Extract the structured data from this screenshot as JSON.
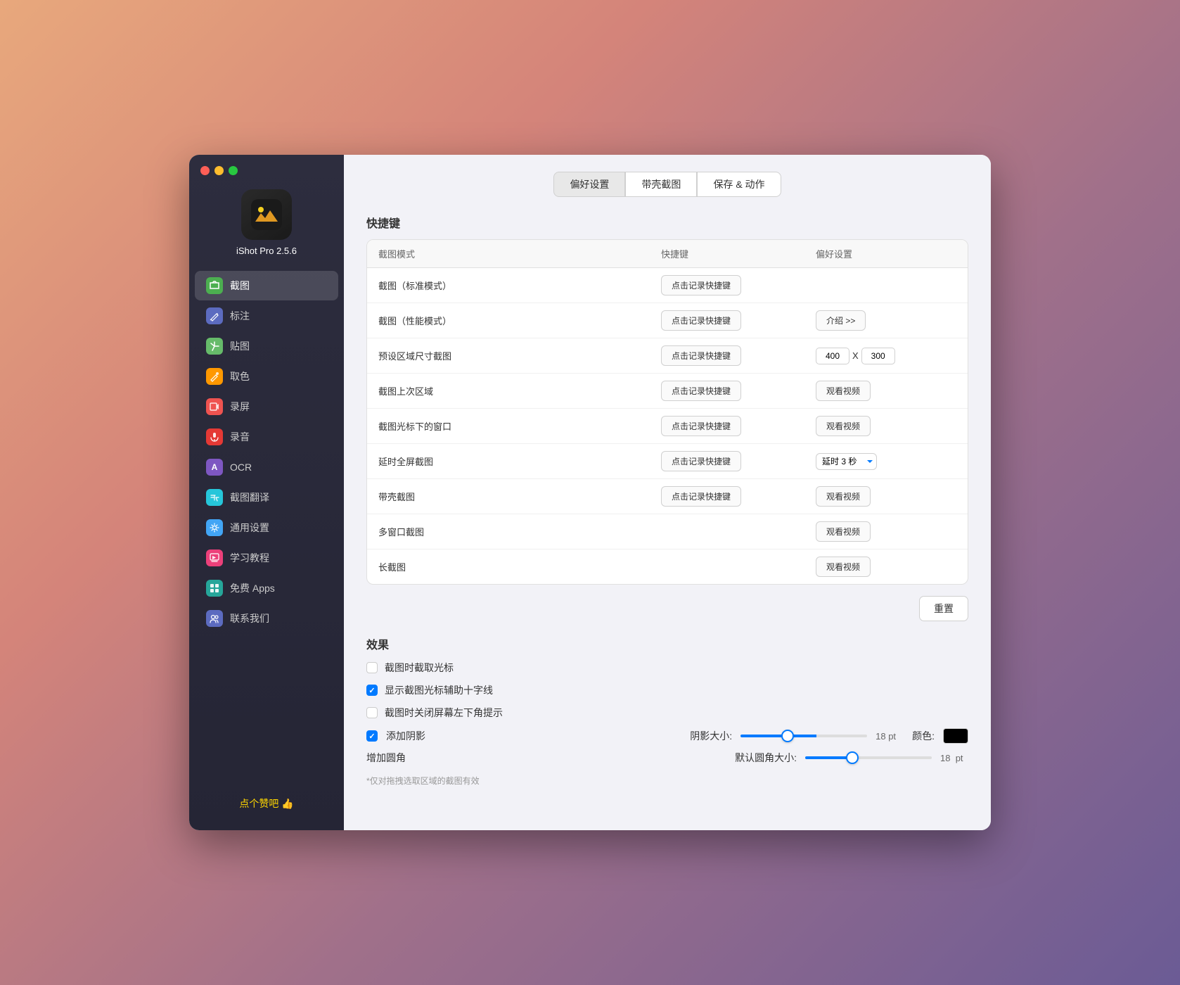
{
  "window": {
    "title": "iShot Pro 2.5.6"
  },
  "titlebar": {
    "close_label": "",
    "minimize_label": "",
    "maximize_label": ""
  },
  "app": {
    "name": "iShot Pro 2.5.6"
  },
  "tabs": [
    {
      "label": "偏好设置",
      "active": true
    },
    {
      "label": "带壳截图",
      "active": false
    },
    {
      "label": "保存 & 动作",
      "active": false
    }
  ],
  "sidebar": {
    "items": [
      {
        "id": "screenshot",
        "label": "截图",
        "icon_class": "icon-screenshot",
        "icon": "🌄",
        "active": true
      },
      {
        "id": "annotate",
        "label": "标注",
        "icon_class": "icon-annotate",
        "icon": "↖",
        "active": false
      },
      {
        "id": "sticker",
        "label": "贴图",
        "icon_class": "icon-sticker",
        "icon": "📌",
        "active": false
      },
      {
        "id": "color",
        "label": "取色",
        "icon_class": "icon-color",
        "icon": "✏",
        "active": false
      },
      {
        "id": "record",
        "label": "录屏",
        "icon_class": "icon-record",
        "icon": "▶",
        "active": false
      },
      {
        "id": "audio",
        "label": "录音",
        "icon_class": "icon-audio",
        "icon": "🎤",
        "active": false
      },
      {
        "id": "ocr",
        "label": "OCR",
        "icon_class": "icon-ocr",
        "icon": "A",
        "active": false
      },
      {
        "id": "translate",
        "label": "截图翻译",
        "icon_class": "icon-translate",
        "icon": "↔",
        "active": false
      },
      {
        "id": "settings",
        "label": "通用设置",
        "icon_class": "icon-settings",
        "icon": "⚙",
        "active": false
      },
      {
        "id": "tutorial",
        "label": "学习教程",
        "icon_class": "icon-tutorial",
        "icon": "▶",
        "active": false
      },
      {
        "id": "apps",
        "label": "免费 Apps",
        "icon_class": "icon-apps",
        "icon": "A",
        "active": false
      },
      {
        "id": "contact",
        "label": "联系我们",
        "icon_class": "icon-contact",
        "icon": "👥",
        "active": false
      }
    ],
    "like_btn": "点个赞吧 👍"
  },
  "shortcuts_section": {
    "title": "快捷键",
    "columns": [
      "截图模式",
      "快捷键",
      "偏好设置"
    ],
    "rows": [
      {
        "mode": "截图（标准模式）",
        "shortcut_btn": "点击记录快捷键",
        "pref": ""
      },
      {
        "mode": "截图（性能模式）",
        "shortcut_btn": "点击记录快捷键",
        "pref": "介绍 >>"
      },
      {
        "mode": "预设区域尺寸截图",
        "shortcut_btn": "点击记录快捷键",
        "pref_type": "size",
        "width": "400",
        "height": "300"
      },
      {
        "mode": "截图上次区域",
        "shortcut_btn": "点击记录快捷键",
        "pref": "观看视频"
      },
      {
        "mode": "截图光标下的窗口",
        "shortcut_btn": "点击记录快捷键",
        "pref": "观看视频"
      },
      {
        "mode": "延时全屏截图",
        "shortcut_btn": "点击记录快捷键",
        "pref_type": "delay",
        "delay_text": "延时 3 秒"
      },
      {
        "mode": "带壳截图",
        "shortcut_btn": "点击记录快捷键",
        "pref": "观看视频"
      },
      {
        "mode": "多窗口截图",
        "shortcut_btn": "",
        "pref": "观看视频"
      },
      {
        "mode": "长截图",
        "shortcut_btn": "",
        "pref": "观看视频"
      }
    ]
  },
  "reset_btn": "重置",
  "effects_section": {
    "title": "效果",
    "checkboxes": [
      {
        "id": "cursor",
        "label": "截图时截取光标",
        "checked": false
      },
      {
        "id": "crosshair",
        "label": "显示截图光标辅助十字线",
        "checked": true
      },
      {
        "id": "close_hint",
        "label": "截图时关闭屏幕左下角提示",
        "checked": false
      }
    ],
    "shadow_row": {
      "checkbox_label": "添加阴影",
      "checked": true,
      "slider_label": "阴影大小:",
      "value": "18",
      "unit": "pt",
      "color_label": "颜色:"
    },
    "corner_row": {
      "label": "增加圆角",
      "slider_label": "默认圆角大小:",
      "value": "18",
      "unit": "pt"
    },
    "note": "*仅对拖拽选取区域的截图有效"
  }
}
